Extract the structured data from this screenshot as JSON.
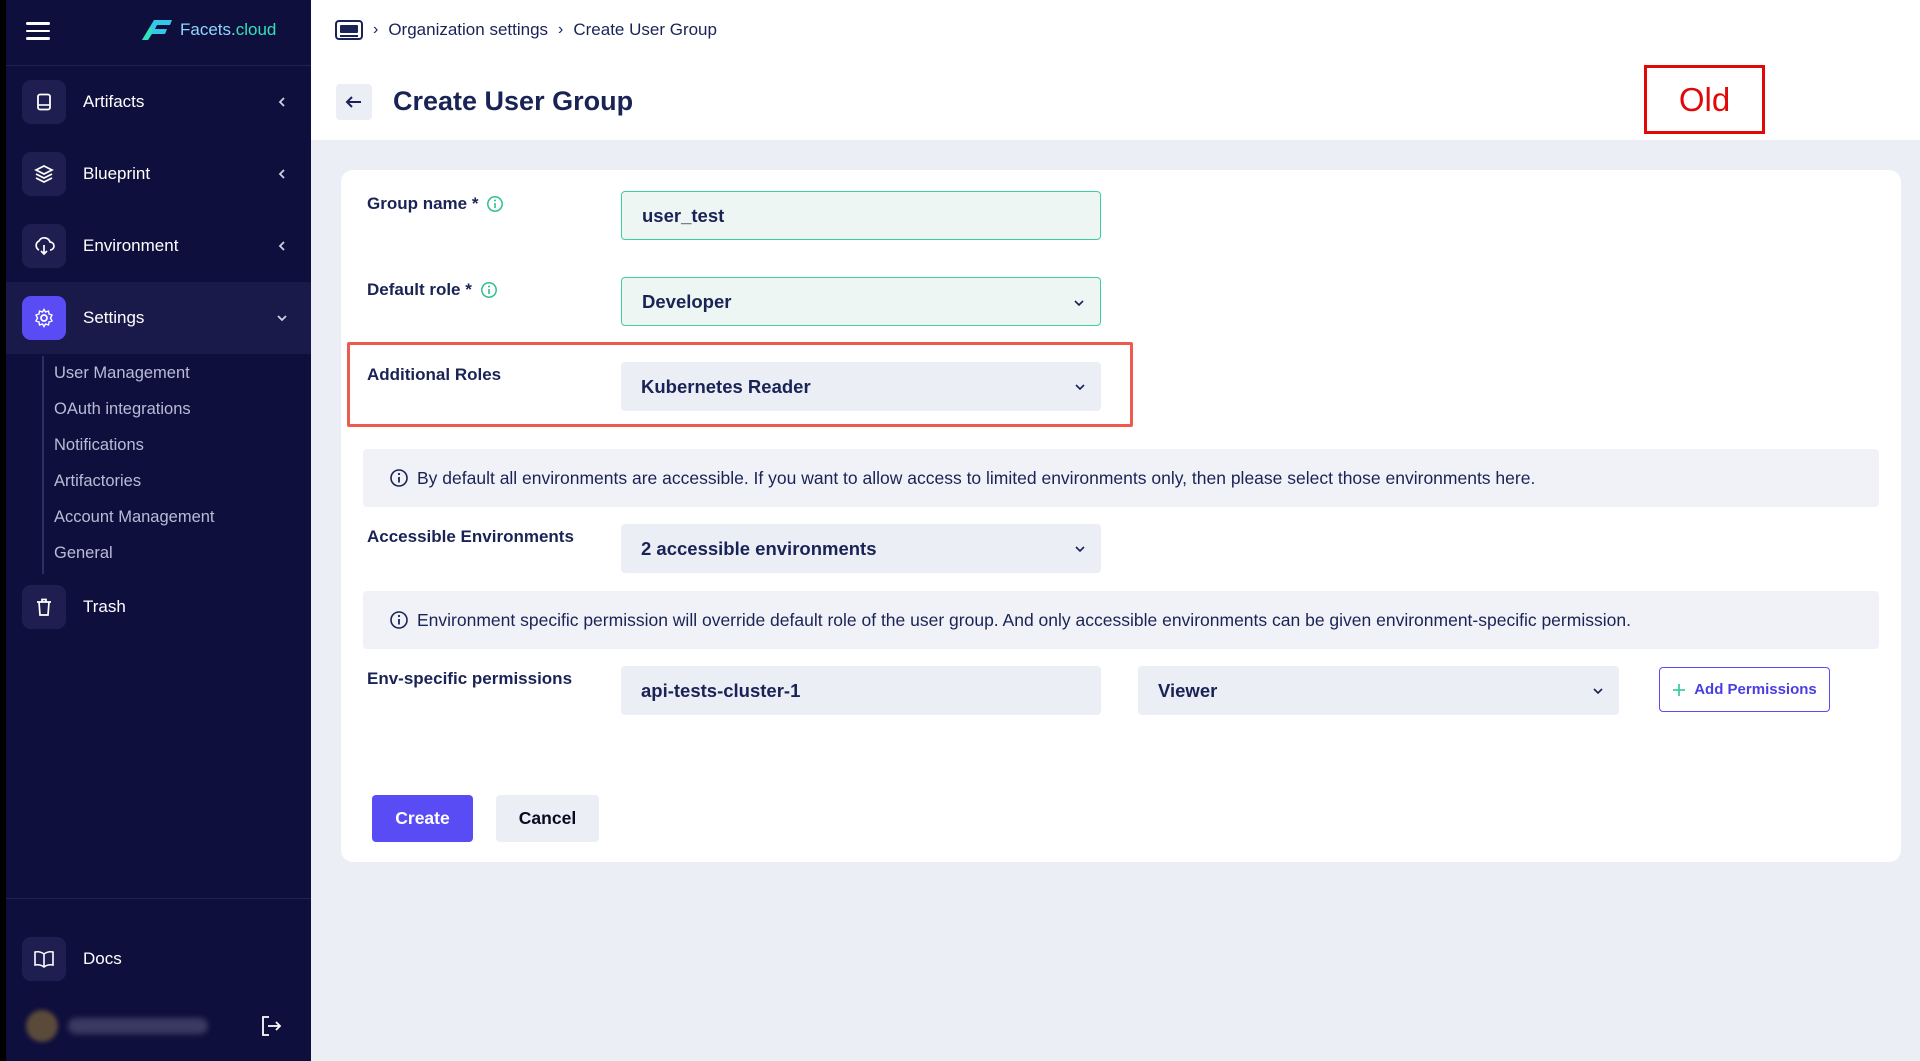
{
  "app": {
    "logo_text": "Facets.",
    "logo_text_accent": "cloud"
  },
  "sidebar": {
    "items": [
      {
        "label": "Artifacts",
        "icon": "book-icon"
      },
      {
        "label": "Blueprint",
        "icon": "layers-icon"
      },
      {
        "label": "Environment",
        "icon": "cloud-download-icon"
      },
      {
        "label": "Settings",
        "icon": "gear-icon"
      }
    ],
    "sub_items": [
      "User Management",
      "OAuth integrations",
      "Notifications",
      "Artifactories",
      "Account Management",
      "General"
    ],
    "trash_label": "Trash",
    "docs_label": "Docs"
  },
  "breadcrumb": {
    "items": [
      "Organization settings",
      "Create User Group"
    ]
  },
  "page": {
    "title": "Create User Group",
    "annotation": "Old"
  },
  "form": {
    "group_name_label": "Group name *",
    "group_name_value": "user_test",
    "default_role_label": "Default role *",
    "default_role_value": "Developer",
    "additional_roles_label": "Additional Roles",
    "additional_roles_value": "Kubernetes Reader",
    "env_notice": "By default all environments are accessible. If you want to allow access to limited environments only, then please select those environments here.",
    "accessible_env_label": "Accessible Environments",
    "accessible_env_value": "2 accessible environments",
    "perm_notice": "Environment specific permission will override default role of the user group. And only accessible environments can be given environment-specific permission.",
    "env_perm_label": "Env-specific permissions",
    "env_perm_env_value": "api-tests-cluster-1",
    "env_perm_role_value": "Viewer",
    "add_permissions_label": "Add Permissions",
    "create_label": "Create",
    "cancel_label": "Cancel"
  },
  "colors": {
    "accent": "#5a4cf5",
    "sidebar_bg": "#0f0f3d",
    "success_border": "#3ecf9a",
    "annotation_red": "#e20808"
  }
}
